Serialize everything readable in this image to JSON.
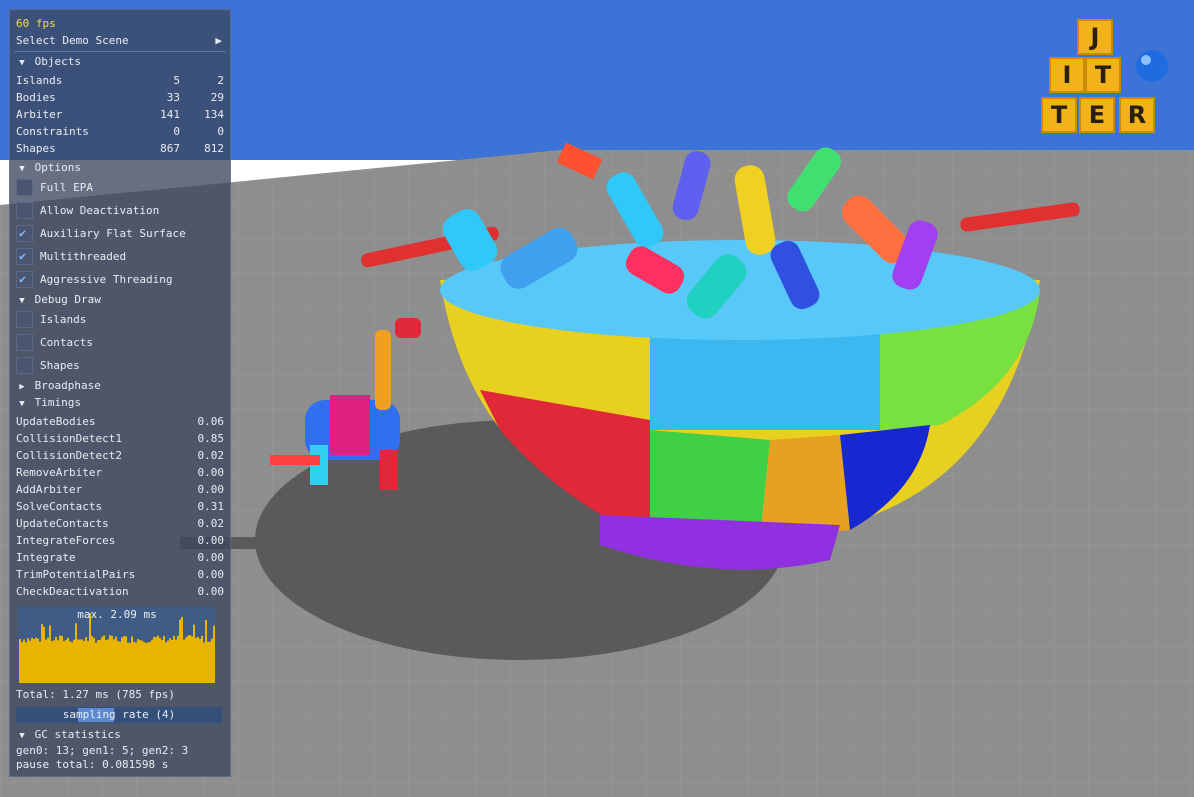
{
  "overlay": {
    "fps": "60 fps",
    "select_scene": "Select Demo Scene",
    "objects": {
      "header": "Objects",
      "rows": [
        {
          "label": "Islands",
          "a": "5",
          "b": "2"
        },
        {
          "label": "Bodies",
          "a": "33",
          "b": "29"
        },
        {
          "label": "Arbiter",
          "a": "141",
          "b": "134"
        },
        {
          "label": "Constraints",
          "a": "0",
          "b": "0"
        },
        {
          "label": "Shapes",
          "a": "867",
          "b": "812"
        }
      ]
    },
    "options": {
      "header": "Options",
      "items": [
        {
          "label": "Full EPA",
          "checked": false
        },
        {
          "label": "Allow Deactivation",
          "checked": false
        },
        {
          "label": "Auxiliary Flat Surface",
          "checked": true
        },
        {
          "label": "Multithreaded",
          "checked": true
        },
        {
          "label": "Aggressive Threading",
          "checked": true
        }
      ]
    },
    "debug_draw": {
      "header": "Debug Draw",
      "items": [
        {
          "label": "Islands",
          "checked": false
        },
        {
          "label": "Contacts",
          "checked": false
        },
        {
          "label": "Shapes",
          "checked": false
        }
      ]
    },
    "broadphase": {
      "header": "Broadphase"
    },
    "timings": {
      "header": "Timings",
      "rows": [
        {
          "label": "UpdateBodies",
          "value": "0.06"
        },
        {
          "label": "CollisionDetect1",
          "value": "0.85"
        },
        {
          "label": "CollisionDetect2",
          "value": "0.02"
        },
        {
          "label": "RemoveArbiter",
          "value": "0.00"
        },
        {
          "label": "AddArbiter",
          "value": "0.00"
        },
        {
          "label": "SolveContacts",
          "value": "0.31"
        },
        {
          "label": "UpdateContacts",
          "value": "0.02"
        },
        {
          "label": "IntegrateForces",
          "value": "0.00"
        },
        {
          "label": "Integrate",
          "value": "0.00"
        },
        {
          "label": "TrimPotentialPairs",
          "value": "0.00"
        },
        {
          "label": "CheckDeactivation",
          "value": "0.00"
        }
      ],
      "histogram_caption": "max. 2.09 ms",
      "total": "Total: 1.27 ms (785 fps)",
      "sampling_label": "sampling rate (4)",
      "sampling_fraction": 0.3
    },
    "gc": {
      "header": "GC statistics",
      "line1": "gen0: 13; gen1: 5; gen2: 3",
      "line2": "pause total: 0.081598 s"
    }
  },
  "logo": {
    "letters": [
      "J",
      "I",
      "T",
      "T",
      "E",
      "R"
    ]
  },
  "colors": {
    "sky": "#3d72d6",
    "floor": "#8f8f8f",
    "histogram_bar": "#e8b400",
    "accent": "#7fb8ff"
  },
  "icons": {
    "expand": "triangle-down-icon",
    "collapse": "triangle-right-icon",
    "play": "play-icon",
    "check": "checkmark-icon"
  }
}
